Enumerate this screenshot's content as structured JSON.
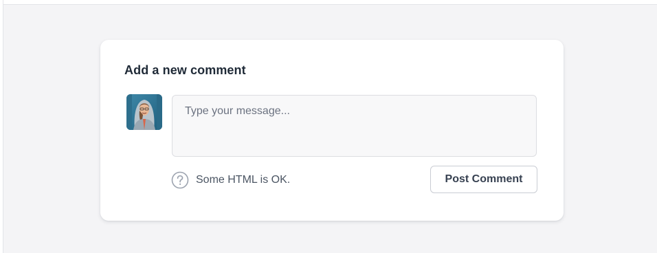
{
  "comment_form": {
    "title": "Add a new comment",
    "avatar_icon": "user-avatar-photo",
    "message_placeholder": "Type your message...",
    "message_value": "",
    "help_icon": "question-circle-icon",
    "help_text": "Some HTML is OK.",
    "post_button_label": "Post Comment"
  },
  "colors": {
    "page_background": "#f4f4f6",
    "card_background": "#ffffff",
    "title_text": "#1f2a37",
    "input_background": "#f8f8f9",
    "input_border": "#dcdde1",
    "button_border": "#c9ccd3",
    "muted_text": "#4b5563"
  }
}
